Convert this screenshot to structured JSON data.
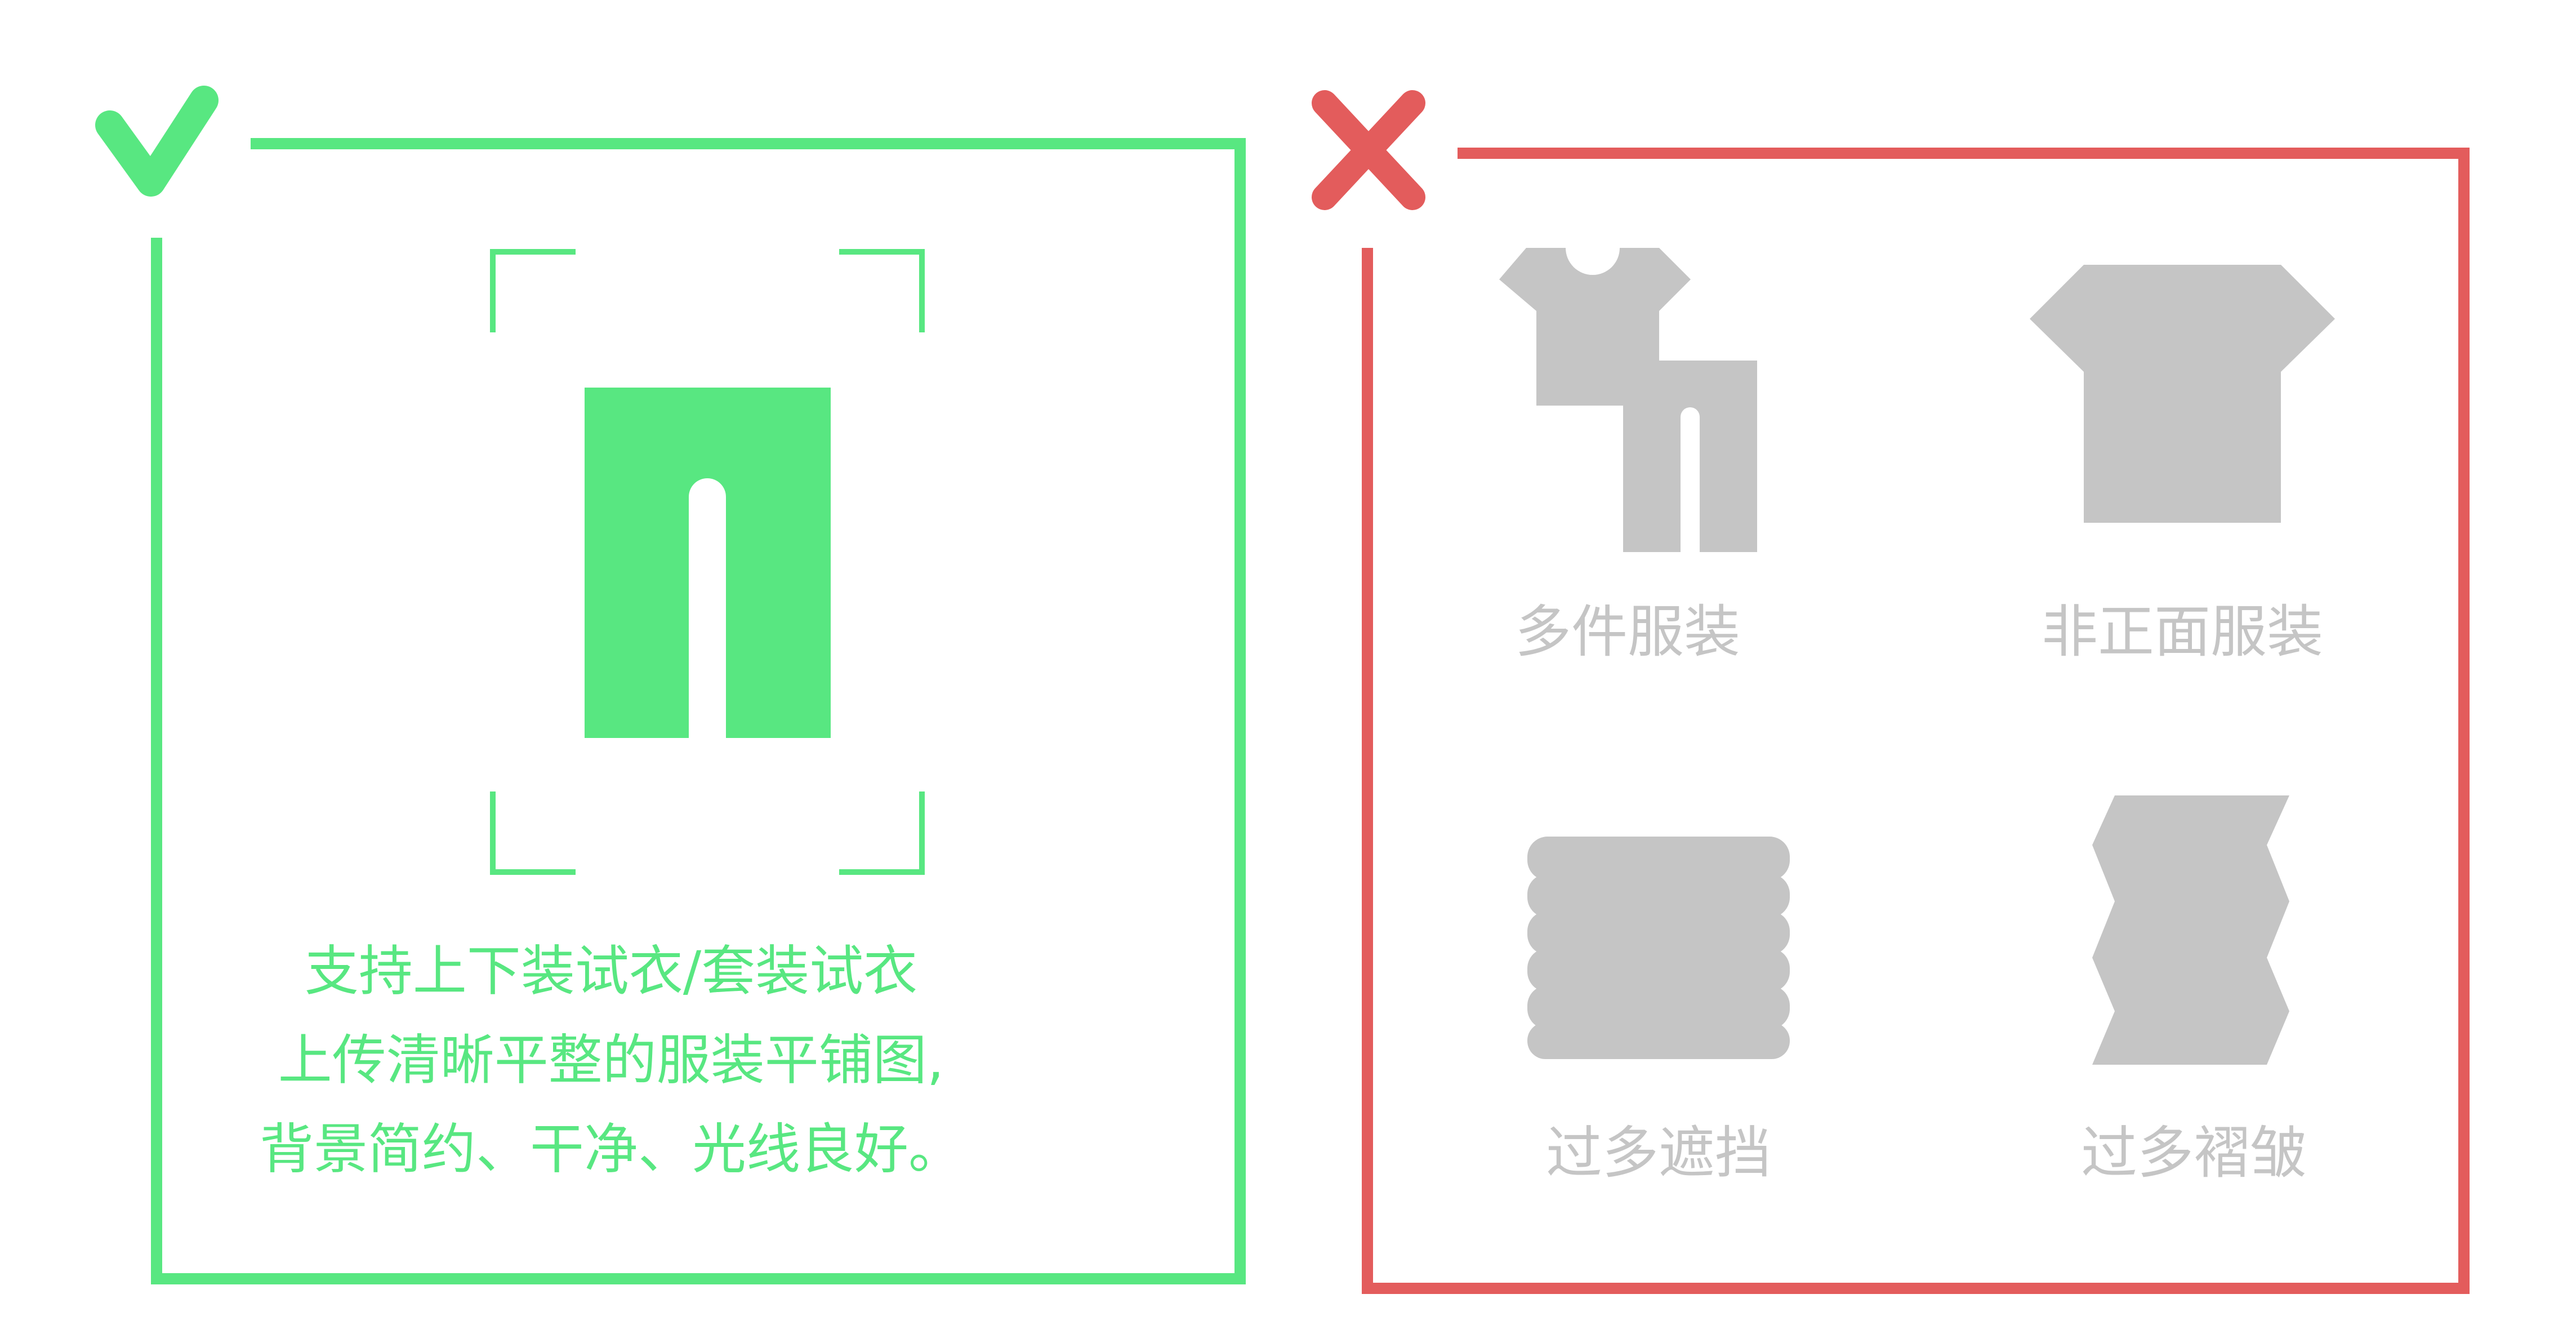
{
  "good_example": {
    "caption_lines": [
      "支持上下装试衣/套装试衣",
      "上传清晰平整的服装平铺图,",
      "背景简约、干净、光线良好。"
    ],
    "icon": "check-icon",
    "accent_color": "#58e781"
  },
  "bad_examples": {
    "icon": "cross-icon",
    "accent_color": "#e35c5c",
    "items": [
      {
        "label": "多件服装",
        "icon": "multiple-garments-icon"
      },
      {
        "label": "非正面服装",
        "icon": "non-frontal-garment-icon"
      },
      {
        "label": "过多遮挡",
        "icon": "excessive-occlusion-icon"
      },
      {
        "label": "过多褶皱",
        "icon": "excessive-wrinkles-icon"
      }
    ],
    "icon_color": "#c5c5c5"
  }
}
